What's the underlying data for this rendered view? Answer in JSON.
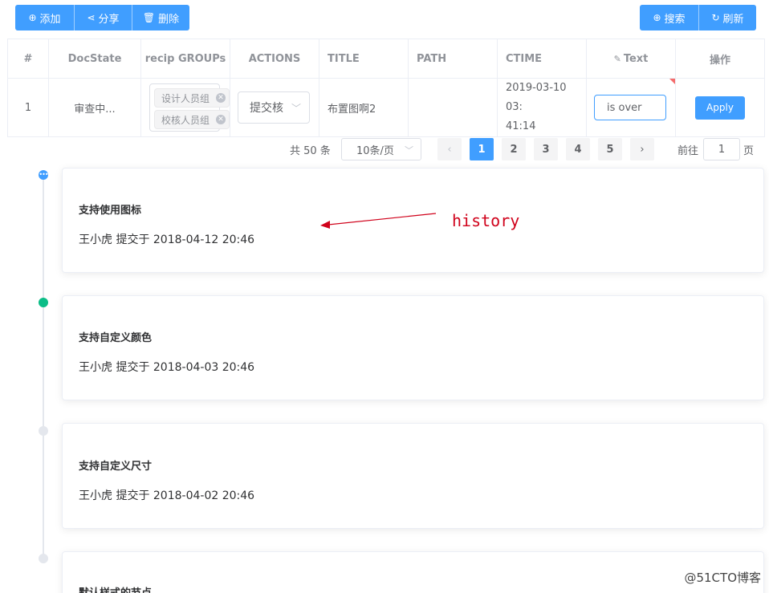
{
  "toolbar": {
    "add_label": "添加",
    "share_label": "分享",
    "delete_label": "删除",
    "search_label": "搜索",
    "refresh_label": "刷新"
  },
  "table": {
    "columns": [
      "#",
      "DocState",
      "recip GROUPs",
      "ACTIONS",
      "TITLE",
      "PATH",
      "CTIME",
      "Text",
      "操作"
    ],
    "row": {
      "index": "1",
      "docstate": "审查中...",
      "groups": [
        "设计人员组",
        "校核人员组"
      ],
      "action_value": "提交核",
      "title": "布置图啊2",
      "path": "",
      "ctime_line1": "2019-03-10 03:",
      "ctime_line2": "41:14",
      "text_value": "is over",
      "apply_label": "Apply"
    }
  },
  "pagination": {
    "total": "共 50 条",
    "page_size": "10条/页",
    "pages": [
      "1",
      "2",
      "3",
      "4",
      "5"
    ],
    "current_page": "1",
    "goto_prefix": "前往",
    "goto_value": "1",
    "goto_suffix": "页"
  },
  "timeline": [
    {
      "title": "支持使用图标",
      "content": "王小虎 提交于 2018-04-12 20:46",
      "dot_color": "#409eff",
      "dot_icon": "more-icon"
    },
    {
      "title": "支持自定义颜色",
      "content": "王小虎 提交于 2018-04-03 20:46",
      "dot_color": "#0bbd87"
    },
    {
      "title": "支持自定义尺寸",
      "content": "王小虎 提交于 2018-04-02 20:46",
      "dot_color": "#e4e7ed"
    },
    {
      "title": "默认样式的节点",
      "content": "",
      "dot_color": "#e4e7ed"
    }
  ],
  "annotation": {
    "text": "history",
    "color": "#d0021b"
  },
  "watermark": "@51CTO博客",
  "colors": {
    "primary": "#409eff",
    "success": "#0bbd87",
    "border": "#ebeef5"
  }
}
